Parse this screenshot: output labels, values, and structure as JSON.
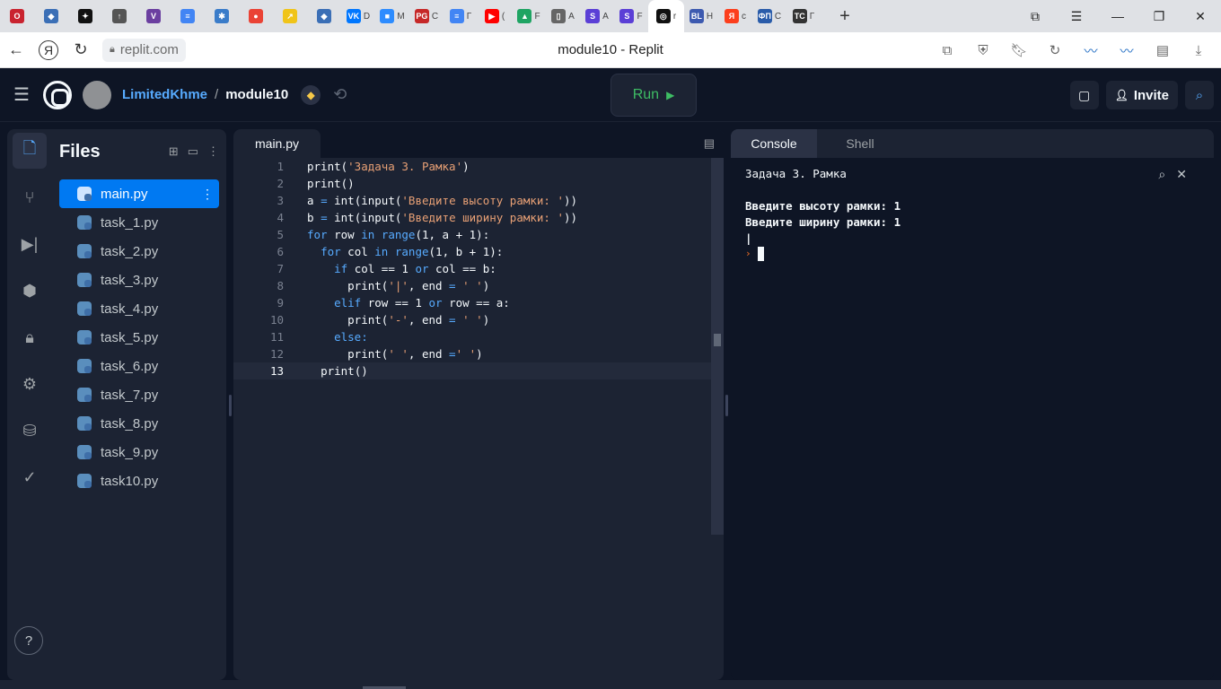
{
  "browser": {
    "tabs": [
      {
        "name": "opera",
        "color": "#c9232f",
        "glyph": "O",
        "title": ""
      },
      {
        "name": "python",
        "color": "#3b6fb6",
        "glyph": "◆",
        "title": ""
      },
      {
        "name": "star",
        "color": "#111111",
        "glyph": "✦",
        "title": ""
      },
      {
        "name": "tab-4",
        "color": "#555555",
        "glyph": "↑",
        "title": ""
      },
      {
        "name": "tab-5",
        "color": "#6b3fa0",
        "glyph": "V",
        "title": ""
      },
      {
        "name": "docs",
        "color": "#4285f4",
        "glyph": "≡",
        "title": ""
      },
      {
        "name": "tab-7",
        "color": "#3a7cc9",
        "glyph": "✱",
        "title": ""
      },
      {
        "name": "chrome",
        "color": "#ea4335",
        "glyph": "●",
        "title": ""
      },
      {
        "name": "tab-9",
        "color": "#f0c419",
        "glyph": "↗",
        "title": ""
      },
      {
        "name": "python2",
        "color": "#3b6fb6",
        "glyph": "◆",
        "title": ""
      },
      {
        "name": "vk",
        "color": "#0077ff",
        "glyph": "VK",
        "title": "D"
      },
      {
        "name": "zoom",
        "color": "#2d8cff",
        "glyph": "■",
        "title": "M"
      },
      {
        "name": "pg",
        "color": "#c62828",
        "glyph": "PG",
        "title": "C"
      },
      {
        "name": "docs2",
        "color": "#4285f4",
        "glyph": "≡",
        "title": "Г"
      },
      {
        "name": "youtube",
        "color": "#ff0000",
        "glyph": "▶",
        "title": "("
      },
      {
        "name": "drive",
        "color": "#1fa463",
        "glyph": "▲",
        "title": "F"
      },
      {
        "name": "file",
        "color": "#666666",
        "glyph": "▯",
        "title": "A"
      },
      {
        "name": "s1",
        "color": "#5b3fd6",
        "glyph": "S",
        "title": "A"
      },
      {
        "name": "s2",
        "color": "#5b3fd6",
        "glyph": "S",
        "title": "F"
      },
      {
        "name": "replit",
        "color": "#111111",
        "glyph": "◎",
        "title": "r"
      },
      {
        "name": "bl",
        "color": "#3d5ab0",
        "glyph": "BL",
        "title": "H"
      },
      {
        "name": "yandex",
        "color": "#fc3f1d",
        "glyph": "Я",
        "title": "c"
      },
      {
        "name": "fp",
        "color": "#2a5caa",
        "glyph": "ФП",
        "title": "C"
      },
      {
        "name": "taskcode",
        "color": "#333333",
        "glyph": "TC",
        "title": "Г"
      }
    ],
    "url": "replit.com",
    "page_title": "module10 - Replit"
  },
  "header": {
    "owner": "LimitedKhme",
    "separator": "/",
    "repl_name": "module10",
    "run_label": "Run",
    "run_icon": "▶",
    "invite_label": "Invite"
  },
  "files": {
    "title": "Files",
    "items": [
      "main.py",
      "task_1.py",
      "task_2.py",
      "task_3.py",
      "task_4.py",
      "task_5.py",
      "task_6.py",
      "task_7.py",
      "task_8.py",
      "task_9.py",
      "task10.py"
    ]
  },
  "editor": {
    "tab": "main.py",
    "lines": [
      {
        "n": "1",
        "tokens": [
          [
            "f",
            "print("
          ],
          [
            "s",
            "'Задача 3. Рамка'"
          ],
          [
            "f",
            ")"
          ]
        ]
      },
      {
        "n": "2",
        "tokens": [
          [
            "f",
            "print()"
          ]
        ]
      },
      {
        "n": "3",
        "tokens": [
          [
            "n",
            "a "
          ],
          [
            "o",
            "="
          ],
          [
            "n",
            " "
          ],
          [
            "f",
            "int(input("
          ],
          [
            "s",
            "'Введите высоту рамки: '"
          ],
          [
            "f",
            "))"
          ]
        ]
      },
      {
        "n": "4",
        "tokens": [
          [
            "n",
            "b "
          ],
          [
            "o",
            "="
          ],
          [
            "n",
            " "
          ],
          [
            "f",
            "int(input("
          ],
          [
            "s",
            "'Введите ширину рамки: '"
          ],
          [
            "f",
            "))"
          ]
        ]
      },
      {
        "n": "5",
        "tokens": [
          [
            "k",
            "for"
          ],
          [
            "n",
            " row "
          ],
          [
            "k",
            "in"
          ],
          [
            "n",
            " "
          ],
          [
            "k",
            "range"
          ],
          [
            "n",
            "(1, a + 1):"
          ]
        ]
      },
      {
        "n": "6",
        "tokens": [
          [
            "n",
            "  "
          ],
          [
            "k",
            "for"
          ],
          [
            "n",
            " col "
          ],
          [
            "k",
            "in"
          ],
          [
            "n",
            " "
          ],
          [
            "k",
            "range"
          ],
          [
            "n",
            "(1, b + 1):"
          ]
        ]
      },
      {
        "n": "7",
        "tokens": [
          [
            "n",
            "    "
          ],
          [
            "k",
            "if"
          ],
          [
            "n",
            " col == 1 "
          ],
          [
            "k",
            "or"
          ],
          [
            "n",
            " col == b:"
          ]
        ]
      },
      {
        "n": "8",
        "tokens": [
          [
            "n",
            "      "
          ],
          [
            "f",
            "print("
          ],
          [
            "s",
            "'|'"
          ],
          [
            "n",
            ", end "
          ],
          [
            "o",
            "="
          ],
          [
            "n",
            " "
          ],
          [
            "s",
            "' '"
          ],
          [
            "f",
            ")"
          ]
        ]
      },
      {
        "n": "9",
        "tokens": [
          [
            "n",
            "    "
          ],
          [
            "k",
            "elif"
          ],
          [
            "n",
            " row == 1 "
          ],
          [
            "k",
            "or"
          ],
          [
            "n",
            " row == a:"
          ]
        ]
      },
      {
        "n": "10",
        "tokens": [
          [
            "n",
            "      "
          ],
          [
            "f",
            "print("
          ],
          [
            "s",
            "'-'"
          ],
          [
            "n",
            ", end "
          ],
          [
            "o",
            "="
          ],
          [
            "n",
            " "
          ],
          [
            "s",
            "' '"
          ],
          [
            "f",
            ")"
          ]
        ]
      },
      {
        "n": "11",
        "tokens": [
          [
            "n",
            "    "
          ],
          [
            "k",
            "else:"
          ]
        ]
      },
      {
        "n": "12",
        "tokens": [
          [
            "n",
            "      "
          ],
          [
            "f",
            "print("
          ],
          [
            "s",
            "' '"
          ],
          [
            "n",
            ", end "
          ],
          [
            "o",
            "="
          ],
          [
            "s",
            "' '"
          ],
          [
            "f",
            ")"
          ]
        ]
      },
      {
        "n": "13",
        "tokens": [
          [
            "n",
            "  "
          ],
          [
            "f",
            "print()"
          ]
        ]
      }
    ],
    "current_line": "13"
  },
  "console": {
    "tabs": [
      "Console",
      "Shell"
    ],
    "active_tab": "Console",
    "title": "Задача 3. Рамка",
    "output": [
      "Введите высоту рамки: 1",
      "Введите ширину рамки: 1",
      "|"
    ],
    "prompt": "›"
  },
  "help_label": "?"
}
